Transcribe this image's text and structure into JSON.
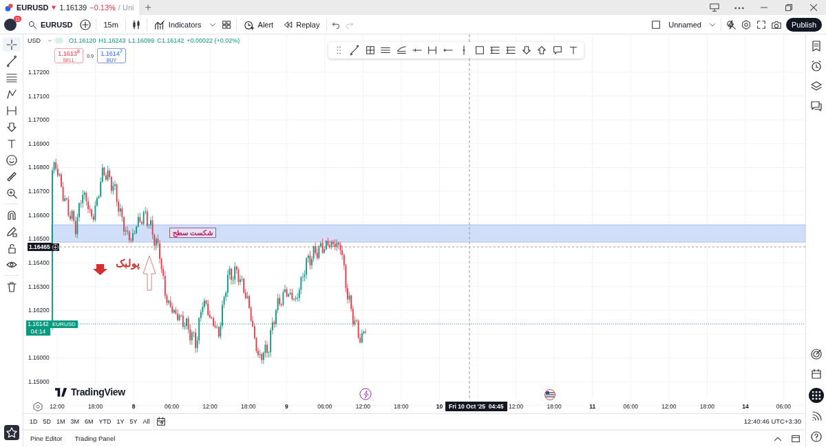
{
  "tab": {
    "symbol": "EURUSD",
    "falling": true,
    "price": "1.16139",
    "change": "−0.13%",
    "title_cut": "/ Uni"
  },
  "new_tab": "+",
  "toolbar": {
    "notification_count": "11",
    "symbol": "EURUSD",
    "interval": "15m",
    "indicators": "Indicators",
    "alert": "Alert",
    "replay": "Replay",
    "layout_name": "Unnamed",
    "publish": "Publish"
  },
  "drawing_tools": [
    {
      "kind": "crosshair",
      "selected": true
    },
    {
      "kind": "line",
      "selected": false
    },
    {
      "kind": "lines",
      "selected": false
    },
    {
      "kind": "nodes",
      "selected": false
    },
    {
      "kind": "bracket",
      "selected": false
    },
    {
      "kind": "arrow",
      "selected": false
    },
    {
      "kind": "text",
      "selected": false
    },
    {
      "kind": "smiley",
      "selected": false
    },
    {
      "kind": "ruler",
      "selected": false
    },
    {
      "kind": "zoom",
      "selected": false
    },
    {
      "kind": "magnet",
      "selected": false
    },
    {
      "kind": "pencil",
      "selected": false
    },
    {
      "kind": "lock",
      "selected": false
    },
    {
      "kind": "eye",
      "selected": false
    },
    {
      "kind": "trash",
      "selected": false
    }
  ],
  "legend": {
    "currency": "USD",
    "open": "O1.16120",
    "high": "H1.16243",
    "low": "L1.16099",
    "close": "C1.16142",
    "change": "+0.00022 (+0.02%)"
  },
  "order": {
    "sell_price": "1.1613$^{8}$",
    "sell_label": "SELL",
    "spread": "0.9",
    "buy_price": "1.1614$^{7}$",
    "buy_label": "BUY"
  },
  "price_ticks": [
    "1.17200",
    "1.17100",
    "1.17000",
    "1.16900",
    "1.16800",
    "1.16700",
    "1.16600",
    "1.16500",
    "1.16400",
    "1.16300",
    "1.16200",
    "1.16000",
    "1.15900"
  ],
  "level_badge": "1.16465",
  "last_price": {
    "price": "1.16142",
    "countdown": "04:14",
    "symbol": "EURUSD"
  },
  "annotations": {
    "zone_label": "شکست سطح",
    "pullback_label": "پولبک"
  },
  "chart_logo": "TradingView",
  "time_ticks": [
    "12:00",
    "18:00",
    "8",
    "06:00",
    "12:00",
    "18:00",
    "9",
    "06:00",
    "12:00",
    "18:00",
    "10",
    "12:00",
    "18:00",
    "11",
    "06:00",
    "12:00",
    "18:00",
    "14",
    "06:00"
  ],
  "crosshair_time": "Fri 10 Oct '25  04:45",
  "ranges": [
    "1D",
    "5D",
    "1M",
    "3M",
    "6M",
    "YTD",
    "1Y",
    "5Y",
    "All"
  ],
  "clock": "12:40:46 UTC+3:30",
  "bottom_tabs": [
    "Pine Editor",
    "Trading Panel"
  ]
}
